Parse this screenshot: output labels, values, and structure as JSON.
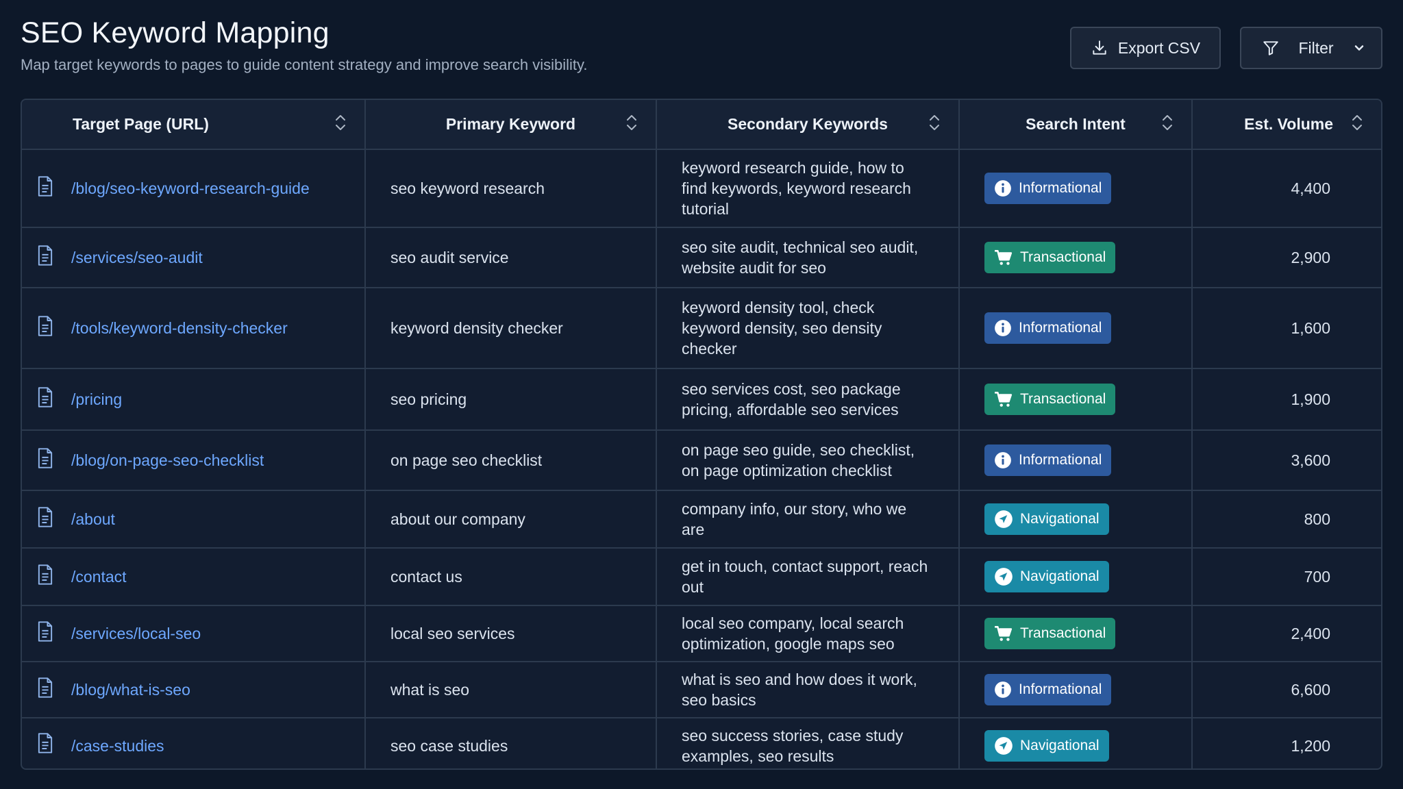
{
  "header": {
    "title": "SEO Keyword Mapping",
    "subtitle": "Map target keywords to pages to guide content strategy and improve search visibility."
  },
  "toolbar": {
    "export_label": "Export CSV",
    "filter_label": "Filter",
    "export_icon": "download-icon",
    "filter_icon": "funnel-icon"
  },
  "columns": [
    {
      "label": "Target Page (URL)"
    },
    {
      "label": "Primary Keyword"
    },
    {
      "label": "Secondary Keywords"
    },
    {
      "label": "Search Intent"
    },
    {
      "label": "Est. Volume"
    }
  ],
  "colors": {
    "informational": "#2d5a9e",
    "transactional": "#1e8a72",
    "navigational": "#1a8aa6",
    "link": "#6ea8ff"
  },
  "rows": [
    {
      "url": "/blog/seo-keyword-research-guide",
      "primary": "seo keyword research",
      "secondary": "keyword research guide, how to find keywords, keyword research tutorial",
      "intent": "Informational",
      "volume": "4,400"
    },
    {
      "url": "/services/seo-audit",
      "primary": "seo audit service",
      "secondary": "seo site audit, technical seo audit, website audit for seo",
      "intent": "Transactional",
      "volume": "2,900"
    },
    {
      "url": "/tools/keyword-density-checker",
      "primary": "keyword density checker",
      "secondary": "keyword density tool, check keyword density, seo density checker",
      "intent": "Informational",
      "volume": "1,600"
    },
    {
      "url": "/pricing",
      "primary": "seo pricing",
      "secondary": "seo services cost, seo package pricing, affordable seo services",
      "intent": "Transactional",
      "volume": "1,900"
    },
    {
      "url": "/blog/on-page-seo-checklist",
      "primary": "on page seo checklist",
      "secondary": "on page seo guide, seo checklist, on page optimization checklist",
      "intent": "Informational",
      "volume": "3,600"
    },
    {
      "url": "/about",
      "primary": "about our company",
      "secondary": "company info, our story, who we are",
      "intent": "Navigational",
      "volume": "800"
    },
    {
      "url": "/contact",
      "primary": "contact us",
      "secondary": "get in touch, contact support, reach out",
      "intent": "Navigational",
      "volume": "700"
    },
    {
      "url": "/services/local-seo",
      "primary": "local seo services",
      "secondary": "local seo company, local search optimization, google maps seo",
      "intent": "Transactional",
      "volume": "2,400"
    },
    {
      "url": "/blog/what-is-seo",
      "primary": "what is seo",
      "secondary": "what is seo and how does it work, seo basics",
      "intent": "Informational",
      "volume": "6,600"
    },
    {
      "url": "/case-studies",
      "primary": "seo case studies",
      "secondary": "seo success stories, case study examples, seo results",
      "intent": "Navigational",
      "volume": "1,200"
    }
  ]
}
